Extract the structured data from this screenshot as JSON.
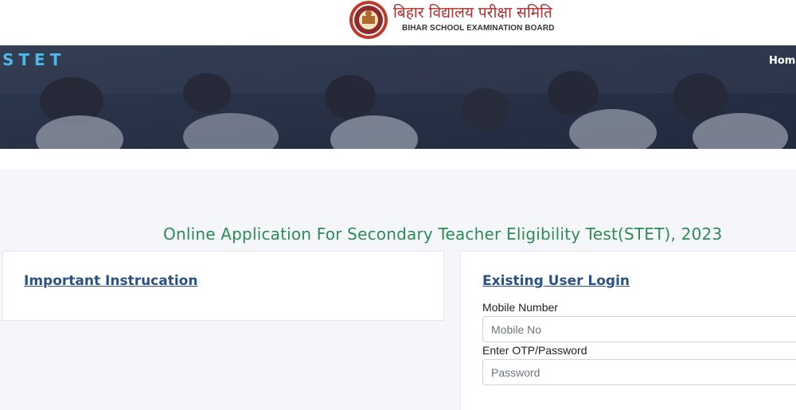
{
  "header": {
    "logo_hindi": "बिहार विद्यालय परीक्षा समिति",
    "logo_english": "BIHAR SCHOOL EXAMINATION BOARD",
    "logo_icon": "board-seal-icon"
  },
  "navbar": {
    "brand": "STET",
    "home_label": "Home"
  },
  "main": {
    "heading": "Online Application For Secondary Teacher Eligibility Test(STET), 2023",
    "instructions_title": "Important Instrucation",
    "login": {
      "title": "Existing User Login",
      "mobile_label": "Mobile Number",
      "mobile_placeholder": "Mobile No",
      "password_label": "Enter OTP/Password",
      "password_placeholder": "Password"
    }
  },
  "colors": {
    "brand_accent": "#4db8e8",
    "heading_green": "#2e8b57",
    "card_title_blue": "#2c5282",
    "logo_red": "#b32d2d"
  }
}
